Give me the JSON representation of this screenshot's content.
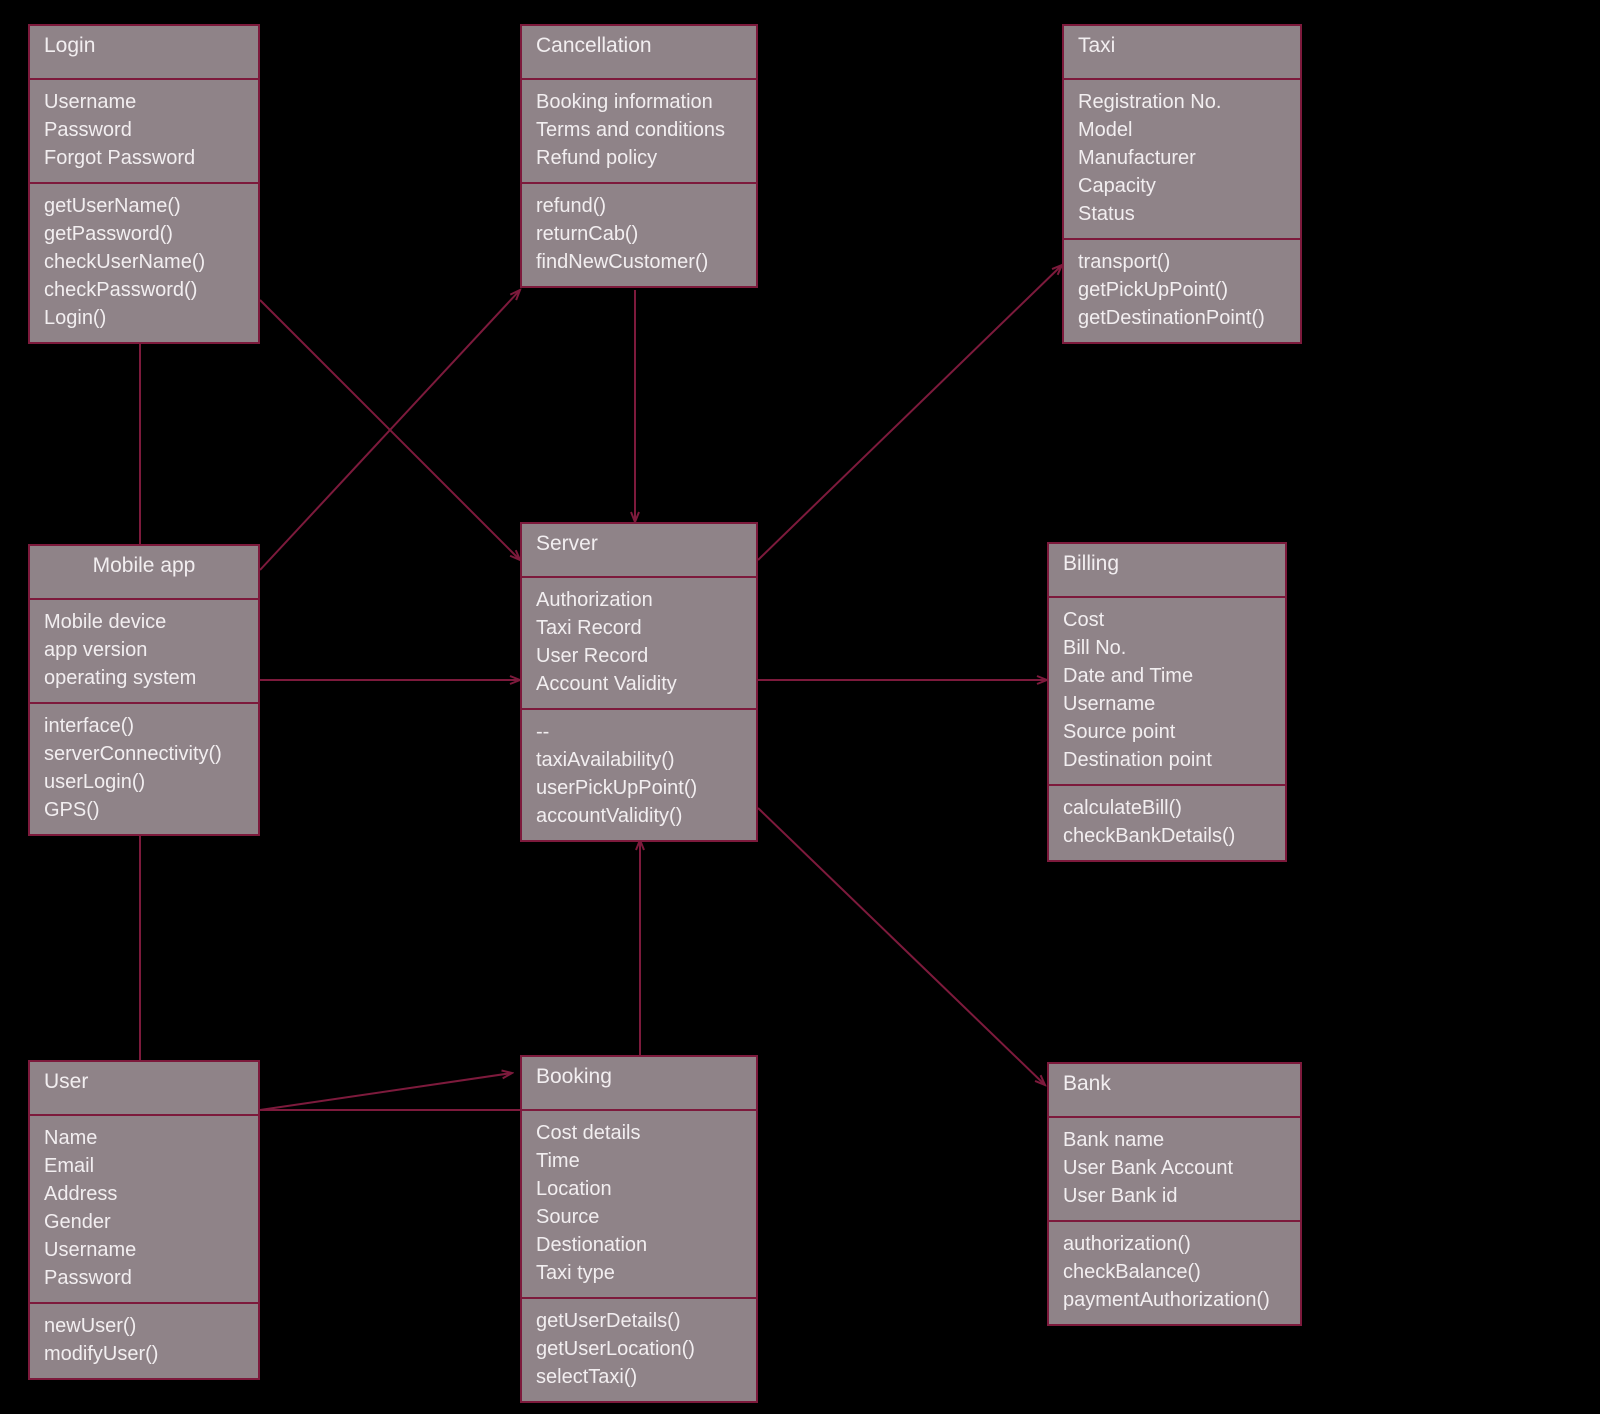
{
  "classes": {
    "login": {
      "title": "Login",
      "attrs": [
        "Username",
        "Password",
        "Forgot Password"
      ],
      "methods": [
        "getUserName()",
        "getPassword()",
        "checkUserName()",
        "checkPassword()",
        "Login()"
      ]
    },
    "cancellation": {
      "title": "Cancellation",
      "attrs": [
        "Booking information",
        "Terms and conditions",
        "Refund policy"
      ],
      "methods": [
        "refund()",
        "returnCab()",
        "findNewCustomer()"
      ]
    },
    "taxi": {
      "title": "Taxi",
      "attrs": [
        "Registration No.",
        "Model",
        "Manufacturer",
        "Capacity",
        "Status"
      ],
      "methods": [
        "transport()",
        "getPickUpPoint()",
        "getDestinationPoint()"
      ]
    },
    "mobileApp": {
      "title": "Mobile app",
      "attrs": [
        "Mobile device",
        "app version",
        "operating system"
      ],
      "methods": [
        "interface()",
        "serverConnectivity()",
        "userLogin()",
        "GPS()"
      ]
    },
    "server": {
      "title": "Server",
      "attrs": [
        "Authorization",
        "Taxi Record",
        "User Record",
        "Account Validity"
      ],
      "methods": [
        "--",
        "taxiAvailability()",
        "userPickUpPoint()",
        "accountValidity()"
      ]
    },
    "billing": {
      "title": "Billing",
      "attrs": [
        "Cost",
        "Bill No.",
        "Date and Time",
        "Username",
        "Source point",
        "Destination point"
      ],
      "methods": [
        "calculateBill()",
        "checkBankDetails()"
      ]
    },
    "user": {
      "title": "User",
      "attrs": [
        "Name",
        "Email",
        "Address",
        "Gender",
        "Username",
        "Password"
      ],
      "methods": [
        "newUser()",
        "modifyUser()"
      ]
    },
    "booking": {
      "title": "Booking",
      "attrs": [
        "Cost details",
        "Time",
        "Location",
        "Source",
        "Destionation",
        "Taxi type"
      ],
      "methods": [
        "getUserDetails()",
        "getUserLocation()",
        "selectTaxi()"
      ]
    },
    "bank": {
      "title": "Bank",
      "attrs": [
        "Bank name",
        "User Bank Account",
        "User Bank id"
      ],
      "methods": [
        "authorization()",
        "checkBalance()",
        "paymentAuthorization()"
      ]
    }
  },
  "colors": {
    "boxFill": "#8f8388",
    "boxBorder": "#7d1a3c",
    "line": "#7d1a3c",
    "text": "#f2eef0"
  }
}
